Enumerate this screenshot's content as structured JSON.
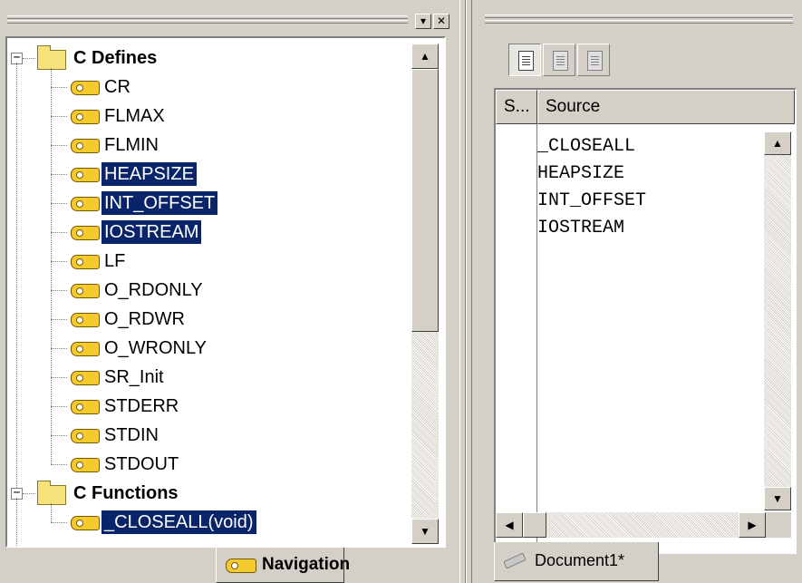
{
  "navigation_panel": {
    "titlebar_buttons": {
      "dropdown": "▾",
      "close": "✕"
    },
    "tree": {
      "groups": [
        {
          "label": "C Defines",
          "expanded": true,
          "items": [
            {
              "label": "CR",
              "selected": false
            },
            {
              "label": "FLMAX",
              "selected": false
            },
            {
              "label": "FLMIN",
              "selected": false
            },
            {
              "label": "HEAPSIZE",
              "selected": true
            },
            {
              "label": "INT_OFFSET",
              "selected": true
            },
            {
              "label": "IOSTREAM",
              "selected": true
            },
            {
              "label": "LF",
              "selected": false
            },
            {
              "label": "O_RDONLY",
              "selected": false
            },
            {
              "label": "O_RDWR",
              "selected": false
            },
            {
              "label": "O_WRONLY",
              "selected": false
            },
            {
              "label": "SR_Init",
              "selected": false
            },
            {
              "label": "STDERR",
              "selected": false
            },
            {
              "label": "STDIN",
              "selected": false
            },
            {
              "label": "STDOUT",
              "selected": false
            }
          ]
        },
        {
          "label": "C Functions",
          "expanded": true,
          "items": [
            {
              "label": "_CLOSEALL(void)",
              "selected": true
            }
          ]
        }
      ]
    },
    "tab_label": "Navigation",
    "icons": {
      "item": "tag-icon",
      "group": "folder-icon",
      "expander": "minus-box-icon"
    }
  },
  "source_panel": {
    "toolbar": [
      {
        "icon": "document-icon",
        "active": true
      },
      {
        "icon": "document-copy-icon",
        "active": false
      },
      {
        "icon": "document-compare-icon",
        "active": false
      }
    ],
    "columns": [
      "S...",
      "Source"
    ],
    "rows": [
      "_CLOSEALL",
      "HEAPSIZE",
      "INT_OFFSET",
      "IOSTREAM"
    ],
    "tab_label": "Document1*"
  },
  "colors": {
    "face": "#d4d0c8",
    "selection": "#0a246a",
    "selection_text": "#ffffff",
    "tag_yellow": "#f5ca2f"
  }
}
